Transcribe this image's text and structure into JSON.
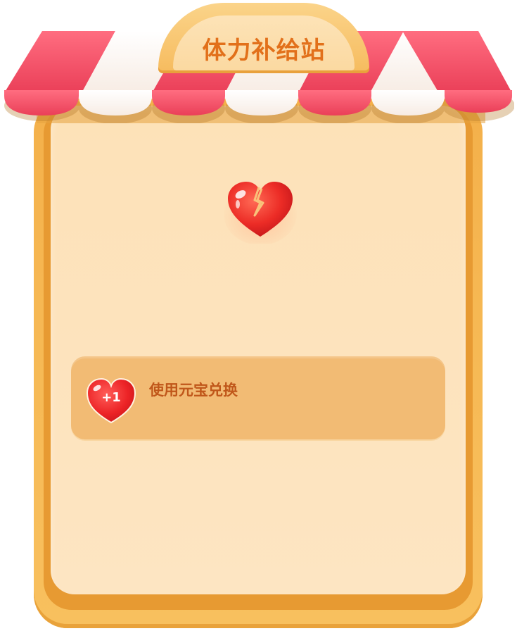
{
  "shop": {
    "title": "体力补给站"
  },
  "exchange_option": {
    "badge": "+1",
    "label": "使用元宝兑换"
  },
  "colors": {
    "awning_red": "#f2536a",
    "awning_white": "#fdf6f0",
    "frame_orange": "#f6b853",
    "panel_cream": "#fde3bd",
    "row_bg": "#f2bb74",
    "title_orange": "#e2701a",
    "label_brown": "#c0571a",
    "heart_red": "#e8232a"
  },
  "icons": {
    "top_heart": "broken-heart-icon",
    "row_heart": "heart-plus-icon"
  }
}
